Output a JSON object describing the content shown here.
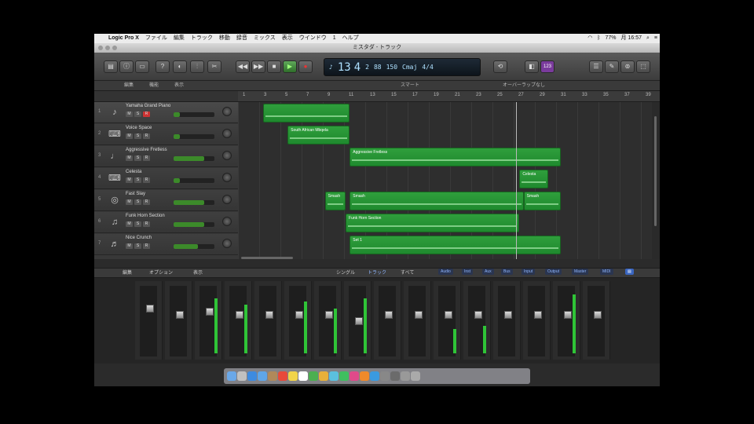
{
  "menubar": {
    "app_name": "Logic Pro X",
    "items": [
      "ファイル",
      "編集",
      "トラック",
      "移動",
      "録音",
      "ミックス",
      "表示",
      "ウインドウ",
      "1",
      "ヘルプ"
    ],
    "battery": "77%",
    "time": "月 16:57"
  },
  "window": {
    "title": "ミスタダ - トラック"
  },
  "lcd": {
    "bar": "13",
    "beat": "4",
    "sub": "2",
    "tempo": "88",
    "key_num": "150",
    "key": "Cmaj",
    "signature": "4/4"
  },
  "trackbar": {
    "edit": "編集",
    "function": "機能",
    "view": "表示",
    "smart": "スマート",
    "drag_mode": "オーバーラップなし"
  },
  "ruler": {
    "ticks": [
      "1",
      "3",
      "5",
      "7",
      "9",
      "11",
      "13",
      "15",
      "17",
      "19",
      "21",
      "23",
      "25",
      "27",
      "29",
      "31",
      "33",
      "35",
      "37",
      "39"
    ]
  },
  "tracks": [
    {
      "num": "1",
      "name": "Yamaha Grand Piano",
      "icon": "piano-icon",
      "level": 0.15
    },
    {
      "num": "2",
      "name": "Voice Space",
      "icon": "keyboard-icon",
      "level": 0.15
    },
    {
      "num": "3",
      "name": "Aggressive Fretless",
      "icon": "bass-icon",
      "level": 0.75
    },
    {
      "num": "4",
      "name": "Celesta",
      "icon": "keyboard-icon",
      "level": 0.15
    },
    {
      "num": "5",
      "name": "Fast Slay",
      "icon": "drums-icon",
      "level": 0.75
    },
    {
      "num": "6",
      "name": "Funk Horn Section",
      "icon": "horn-icon",
      "level": 0.75
    },
    {
      "num": "7",
      "name": "Nice Crunch",
      "icon": "guitar-icon",
      "level": 0.6
    }
  ],
  "regions": [
    {
      "track": 0,
      "label": "",
      "start": 0.06,
      "end": 0.27
    },
    {
      "track": 1,
      "label": "South African Mbqela",
      "start": 0.12,
      "end": 0.27
    },
    {
      "track": 2,
      "label": "Aggressive Fretless",
      "start": 0.27,
      "end": 0.78
    },
    {
      "track": 3,
      "label": "Celesta",
      "start": 0.68,
      "end": 0.75
    },
    {
      "track": 4,
      "label": "Smash",
      "start": 0.21,
      "end": 0.26
    },
    {
      "track": 4,
      "label": "Smash",
      "start": 0.27,
      "end": 0.69
    },
    {
      "track": 4,
      "label": "Smash",
      "start": 0.69,
      "end": 0.78
    },
    {
      "track": 5,
      "label": "Funk Horn Section",
      "start": 0.26,
      "end": 0.68
    },
    {
      "track": 6,
      "label": "Set 1",
      "start": 0.27,
      "end": 0.78
    }
  ],
  "mixerbar": {
    "edit": "編集",
    "options": "オプション",
    "view": "表示",
    "single": "シングル",
    "tracks": "トラック",
    "all": "すべて",
    "filters": [
      "Audio",
      "Inst",
      "Aux",
      "Bus",
      "Input",
      "Output",
      "Master",
      "MIDI"
    ]
  },
  "mixer": {
    "strips": [
      {
        "fader": 0.7,
        "meter": 0.0
      },
      {
        "fader": 0.6,
        "meter": 0.0
      },
      {
        "fader": 0.65,
        "meter": 0.8
      },
      {
        "fader": 0.6,
        "meter": 0.7
      },
      {
        "fader": 0.6,
        "meter": 0.0
      },
      {
        "fader": 0.6,
        "meter": 0.75
      },
      {
        "fader": 0.6,
        "meter": 0.65
      },
      {
        "fader": 0.5,
        "meter": 0.8
      },
      {
        "fader": 0.6,
        "meter": 0.0
      },
      {
        "fader": 0.6,
        "meter": 0.0
      },
      {
        "fader": 0.6,
        "meter": 0.35
      },
      {
        "fader": 0.6,
        "meter": 0.4
      },
      {
        "fader": 0.6,
        "meter": 0.0
      },
      {
        "fader": 0.6,
        "meter": 0.0
      },
      {
        "fader": 0.6,
        "meter": 0.85
      },
      {
        "fader": 0.6,
        "meter": 0.0
      }
    ]
  },
  "dock": {
    "icons": [
      "finder-icon",
      "launchpad-icon",
      "safari-icon",
      "mail-icon",
      "contacts-icon",
      "calendar-icon",
      "notes-icon",
      "reminders-icon",
      "maps-icon",
      "photos-icon",
      "messages-icon",
      "facetime-icon",
      "itunes-icon",
      "ibooks-icon",
      "appstore-icon",
      "preferences-icon",
      "logic-icon",
      "gear-icon",
      "trash-icon"
    ]
  },
  "colors": {
    "region": "#2f9e3c",
    "record": "#cc3333",
    "lcd_text": "#aee0ff",
    "meter": "#2fc437"
  }
}
